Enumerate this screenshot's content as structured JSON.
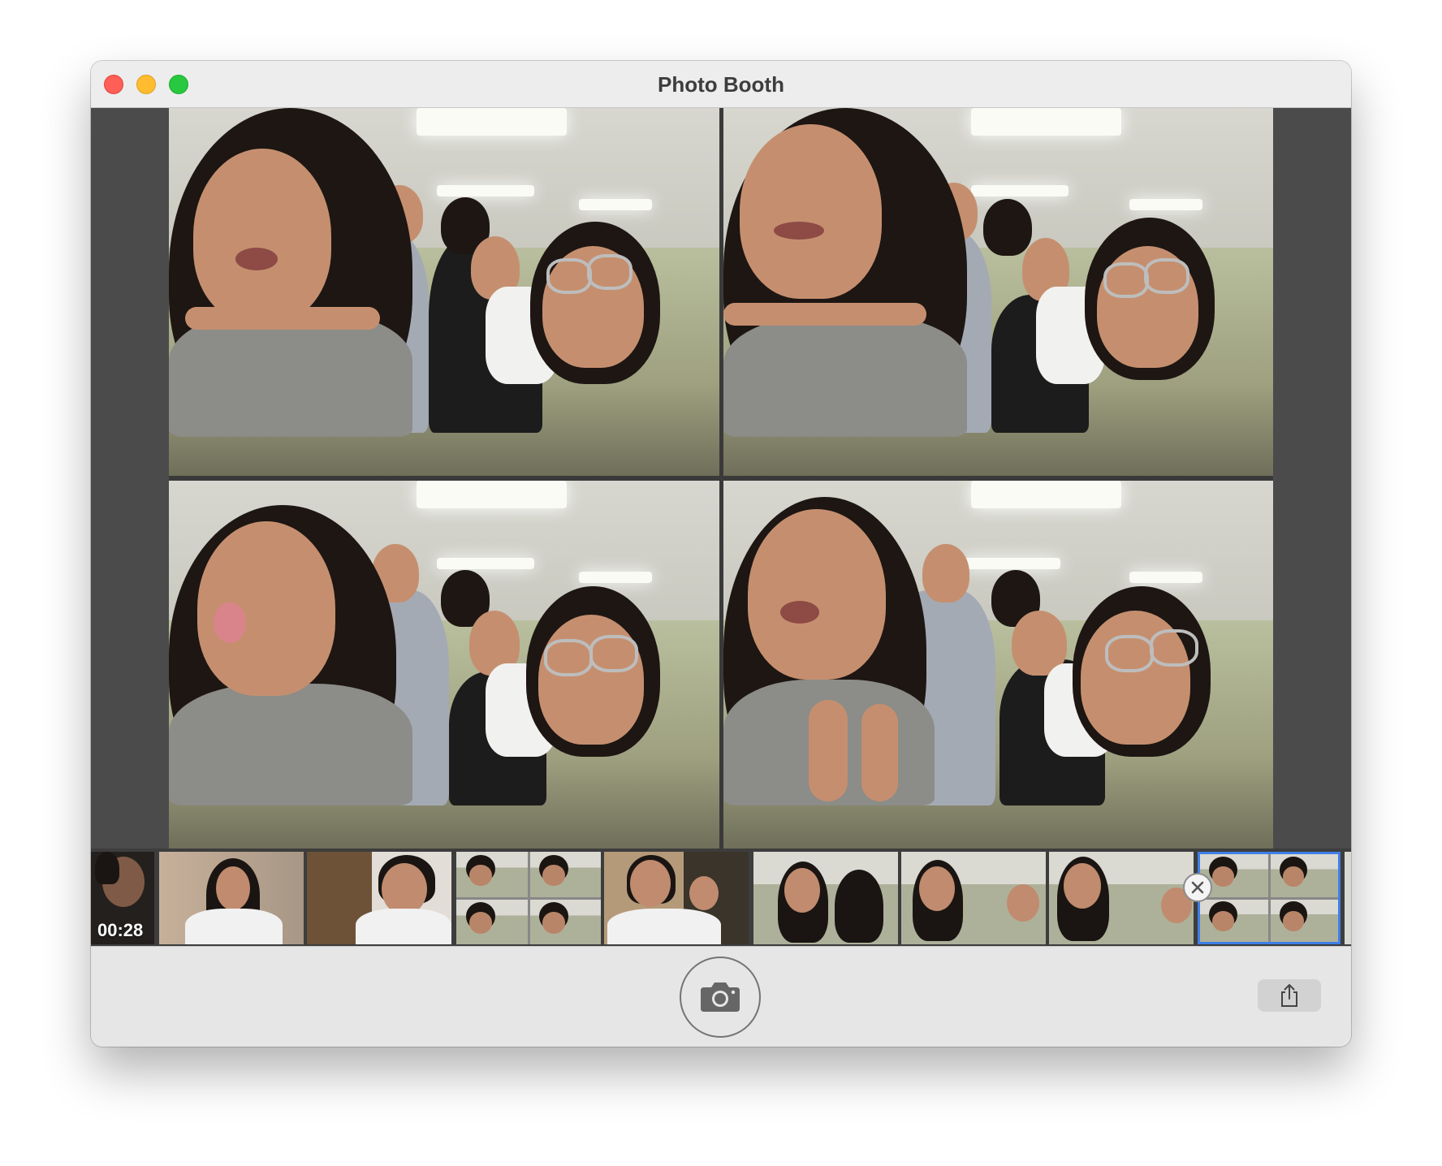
{
  "window": {
    "title": "Photo Booth"
  },
  "viewer": {
    "layout": "four-up",
    "photos": [
      {
        "label": "photo-1"
      },
      {
        "label": "photo-2"
      },
      {
        "label": "photo-3"
      },
      {
        "label": "photo-4"
      }
    ]
  },
  "filmstrip": {
    "items": [
      {
        "type": "video",
        "duration": "00:28"
      },
      {
        "type": "photo"
      },
      {
        "type": "photo"
      },
      {
        "type": "four-up"
      },
      {
        "type": "photo"
      },
      {
        "type": "photo"
      },
      {
        "type": "photo"
      },
      {
        "type": "photo"
      },
      {
        "type": "four-up",
        "selected": true
      }
    ],
    "selected_index": 8
  },
  "toolbar": {
    "shutter_icon": "camera-icon",
    "share_icon": "share-icon"
  },
  "colors": {
    "selection": "#3e7ee8",
    "close": "#ff5f57",
    "minimize": "#febc2e",
    "zoom": "#28c840"
  }
}
